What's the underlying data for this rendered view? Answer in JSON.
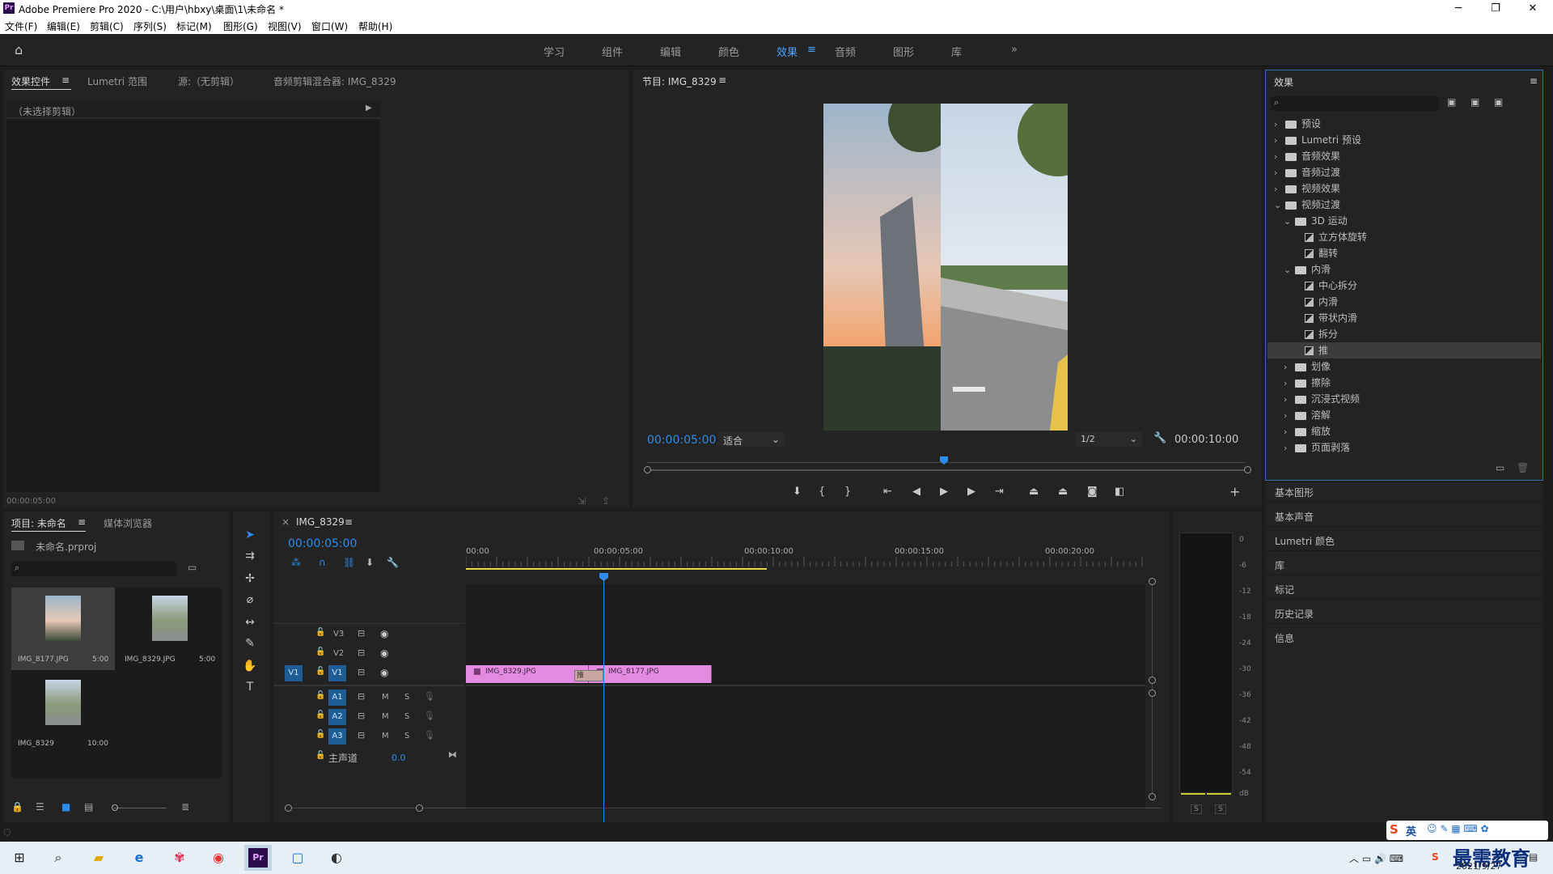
{
  "window": {
    "title": "Adobe Premiere Pro 2020 - C:\\用户\\hbxy\\桌面\\1\\未命名 *",
    "logo": "Pr",
    "min": "─",
    "max": "❐",
    "close": "✕"
  },
  "menu": [
    "文件(F)",
    "编辑(E)",
    "剪辑(C)",
    "序列(S)",
    "标记(M)",
    "图形(G)",
    "视图(V)",
    "窗口(W)",
    "帮助(H)"
  ],
  "workspaces": [
    "学习",
    "组件",
    "编辑",
    "颜色",
    "效果",
    "音频",
    "图形",
    "库"
  ],
  "workspace_active": "效果",
  "more": "»",
  "source_panel": {
    "tabs": [
      "效果控件",
      "Lumetri 范围",
      "源:（无剪辑）",
      "音频剪辑混合器: IMG_8329"
    ],
    "no_clip": "（未选择剪辑）",
    "timecode": "00:00:05:00"
  },
  "program": {
    "title": "节目: IMG_8329",
    "timecode": "00:00:05:00",
    "fit": "适合",
    "quality": "1/2",
    "duration": "00:00:10:00",
    "playhead": 0.5
  },
  "effects_panel": {
    "title": "效果",
    "tree": [
      {
        "label": "预设",
        "level": 0,
        "kind": "folder",
        "open": false
      },
      {
        "label": "Lumetri 预设",
        "level": 0,
        "kind": "folder",
        "open": false
      },
      {
        "label": "音频效果",
        "level": 0,
        "kind": "folder",
        "open": false
      },
      {
        "label": "音频过渡",
        "level": 0,
        "kind": "folder",
        "open": false
      },
      {
        "label": "视频效果",
        "level": 0,
        "kind": "folder",
        "open": false
      },
      {
        "label": "视频过渡",
        "level": 0,
        "kind": "folder",
        "open": true
      },
      {
        "label": "3D 运动",
        "level": 1,
        "kind": "folder",
        "open": true
      },
      {
        "label": "立方体旋转",
        "level": 2,
        "kind": "fx"
      },
      {
        "label": "翻转",
        "level": 2,
        "kind": "fx"
      },
      {
        "label": "内滑",
        "level": 1,
        "kind": "folder",
        "open": true
      },
      {
        "label": "中心拆分",
        "level": 2,
        "kind": "fx"
      },
      {
        "label": "内滑",
        "level": 2,
        "kind": "fx"
      },
      {
        "label": "带状内滑",
        "level": 2,
        "kind": "fx"
      },
      {
        "label": "拆分",
        "level": 2,
        "kind": "fx"
      },
      {
        "label": "推",
        "level": 2,
        "kind": "fx",
        "selected": true
      },
      {
        "label": "划像",
        "level": 1,
        "kind": "folder",
        "open": false
      },
      {
        "label": "擦除",
        "level": 1,
        "kind": "folder",
        "open": false
      },
      {
        "label": "沉浸式视频",
        "level": 1,
        "kind": "folder",
        "open": false
      },
      {
        "label": "溶解",
        "level": 1,
        "kind": "folder",
        "open": false
      },
      {
        "label": "缩放",
        "level": 1,
        "kind": "folder",
        "open": false
      },
      {
        "label": "页面剥落",
        "level": 1,
        "kind": "folder",
        "open": false
      }
    ]
  },
  "side_panels": [
    "基本图形",
    "基本声音",
    "Lumetri 颜色",
    "库",
    "标记",
    "历史记录",
    "信息"
  ],
  "project": {
    "tabs": [
      "项目: 未命名",
      "媒体浏览器"
    ],
    "file": "未命名.prproj",
    "items": [
      {
        "name": "IMG_8177.JPG",
        "dur": "5:00"
      },
      {
        "name": "IMG_8329.JPG",
        "dur": "5:00"
      },
      {
        "name": "IMG_8329",
        "dur": "10:00"
      }
    ]
  },
  "timeline": {
    "tab": "IMG_8329",
    "close": "×",
    "timecode": "00:00:05:00",
    "ruler": [
      "00:00",
      "00:00:05:00",
      "00:00:10:00",
      "00:00:15:00",
      "00:00:20:00"
    ],
    "video_tracks": [
      "V3",
      "V2",
      "V1"
    ],
    "audio_tracks": [
      "A1",
      "A2",
      "A3"
    ],
    "source_patch": "V1",
    "master": "主声道",
    "master_val": "0.0",
    "clips": [
      {
        "name": "IMG_8329.JPG",
        "start": 0,
        "end": 5
      },
      {
        "name": "IMG_8177.JPG",
        "start": 5,
        "end": 10
      }
    ],
    "transition": "推",
    "m": "M",
    "s": "S"
  },
  "meter": {
    "labels": [
      "0",
      "-6",
      "-12",
      "-18",
      "-24",
      "-30",
      "-36",
      "-42",
      "-48",
      "-54",
      "dB"
    ],
    "s1": "S",
    "s2": "S"
  },
  "taskbar": {
    "date": "2021/9/27",
    "ime": "英",
    "watermark": "最需教育"
  }
}
